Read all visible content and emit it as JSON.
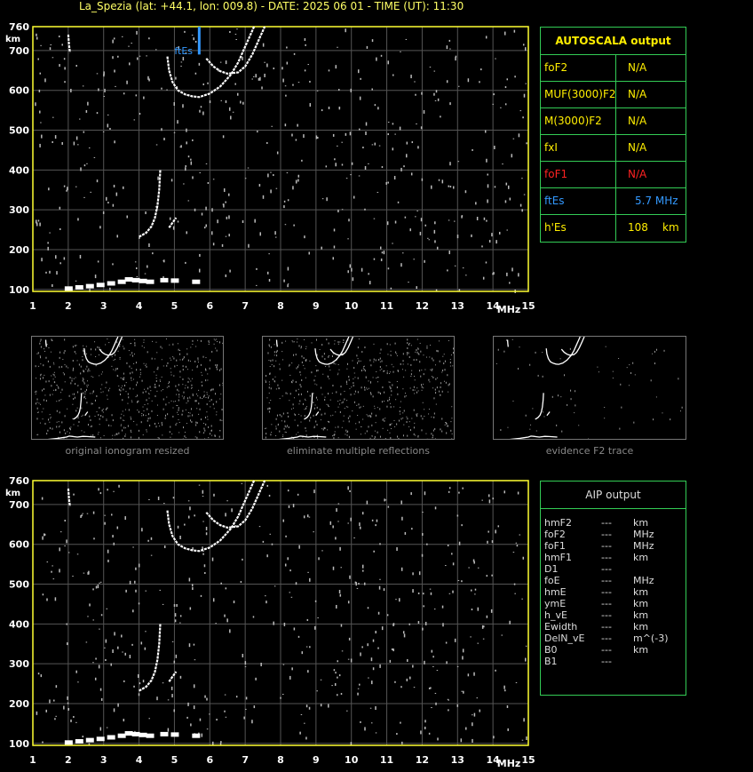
{
  "title": "La_Spezia (lat: +44.1, lon: 009.8) - DATE: 2025 06 01 - TIME (UT): 11:30",
  "chart_data": [
    {
      "type": "scatter",
      "name": "ionogram-main",
      "xlabel": "MHz",
      "ylabel": "km",
      "xlim": [
        1,
        15
      ],
      "ylim": [
        95,
        760
      ],
      "x_ticks": [
        "1",
        "2",
        "3",
        "4",
        "5",
        "6",
        "7",
        "8",
        "9",
        "10",
        "11",
        "12",
        "13",
        "14",
        "15"
      ],
      "y_ticks": [
        "100",
        "200",
        "300",
        "400",
        "500",
        "600",
        "700",
        "760"
      ],
      "grid": true,
      "annotation": {
        "label": "ftEs",
        "freq": 5.7
      },
      "traces": {
        "es_low": [
          [
            2.0,
            101
          ],
          [
            2.3,
            104
          ],
          [
            2.6,
            107
          ],
          [
            2.9,
            110
          ],
          [
            3.2,
            114
          ],
          [
            3.5,
            118
          ],
          [
            3.7,
            124
          ],
          [
            3.9,
            122
          ],
          [
            4.1,
            120
          ],
          [
            4.3,
            118
          ],
          [
            4.7,
            122
          ],
          [
            5.0,
            121
          ],
          [
            5.6,
            118
          ]
        ],
        "f_rise": [
          [
            4.0,
            232
          ],
          [
            4.2,
            242
          ],
          [
            4.35,
            258
          ],
          [
            4.45,
            280
          ],
          [
            4.52,
            310
          ],
          [
            4.57,
            350
          ],
          [
            4.6,
            400
          ]
        ],
        "f_small": [
          [
            4.85,
            255
          ],
          [
            4.95,
            268
          ],
          [
            5.05,
            280
          ]
        ],
        "f2_o": [
          [
            4.8,
            685
          ],
          [
            4.85,
            650
          ],
          [
            4.95,
            620
          ],
          [
            5.1,
            600
          ],
          [
            5.3,
            590
          ],
          [
            5.5,
            585
          ],
          [
            5.7,
            583
          ],
          [
            6.0,
            592
          ],
          [
            6.3,
            610
          ],
          [
            6.6,
            640
          ],
          [
            6.8,
            670
          ],
          [
            7.0,
            710
          ],
          [
            7.15,
            740
          ],
          [
            7.25,
            760
          ]
        ],
        "f2_x": [
          [
            5.9,
            680
          ],
          [
            6.1,
            660
          ],
          [
            6.3,
            648
          ],
          [
            6.5,
            642
          ],
          [
            6.8,
            645
          ],
          [
            7.0,
            660
          ],
          [
            7.2,
            690
          ],
          [
            7.4,
            730
          ],
          [
            7.55,
            760
          ]
        ],
        "upper_left": [
          [
            2.0,
            740
          ],
          [
            2.02,
            715
          ],
          [
            2.05,
            695
          ]
        ]
      }
    },
    {
      "type": "scatter",
      "name": "ionogram-aip",
      "xlabel": "MHz",
      "ylabel": "km",
      "xlim": [
        1,
        15
      ],
      "ylim": [
        95,
        760
      ],
      "x_ticks": [
        "1",
        "2",
        "3",
        "4",
        "5",
        "6",
        "7",
        "8",
        "9",
        "10",
        "11",
        "12",
        "13",
        "14",
        "15"
      ],
      "y_ticks": [
        "100",
        "200",
        "300",
        "400",
        "500",
        "600",
        "700",
        "760"
      ],
      "grid": true
    }
  ],
  "autoscala": {
    "title": "AUTOSCALA output",
    "rows": [
      {
        "key": "foF2",
        "value": "N/A",
        "color": "#ffee00"
      },
      {
        "key": "MUF(3000)F2",
        "value": "N/A",
        "color": "#ffee00"
      },
      {
        "key": "M(3000)F2",
        "value": "N/A",
        "color": "#ffee00"
      },
      {
        "key": "fxI",
        "value": "N/A",
        "color": "#ffee00"
      },
      {
        "key": "foF1",
        "value": "N/A",
        "color": "#ff2222"
      },
      {
        "key": "ftEs",
        "value": "5.7 MHz",
        "color": "#3399ff"
      },
      {
        "key": "h'Es",
        "value": "108",
        "unit": "km",
        "color": "#ffee00"
      }
    ]
  },
  "thumbnails": [
    {
      "caption": "original ionogram resized"
    },
    {
      "caption": "eliminate multiple reflections"
    },
    {
      "caption": "evidence F2 trace"
    }
  ],
  "aip": {
    "title": "AIP output",
    "rows": [
      {
        "key": "hmF2",
        "value": "---",
        "unit": "km"
      },
      {
        "key": "foF2",
        "value": "---",
        "unit": "MHz"
      },
      {
        "key": "foF1",
        "value": "---",
        "unit": "MHz"
      },
      {
        "key": "hmF1",
        "value": "---",
        "unit": "km"
      },
      {
        "key": "D1",
        "value": "---",
        "unit": ""
      },
      {
        "key": "foE",
        "value": "---",
        "unit": "MHz"
      },
      {
        "key": "hmE",
        "value": "---",
        "unit": "km"
      },
      {
        "key": "ymE",
        "value": "---",
        "unit": "km"
      },
      {
        "key": "h_vE",
        "value": "---",
        "unit": "km"
      },
      {
        "key": "Ewidth",
        "value": "---",
        "unit": "km"
      },
      {
        "key": "DelN_vE",
        "value": "---",
        "unit": "m^(-3)"
      },
      {
        "key": "B0",
        "value": "---",
        "unit": "km"
      },
      {
        "key": "B1",
        "value": "---",
        "unit": ""
      }
    ]
  },
  "colors": {
    "frame": "#ffff33",
    "grid": "#555555",
    "panel_border": "#33cc55",
    "trace": "#ffffff",
    "ftes_marker": "#3399ff"
  }
}
